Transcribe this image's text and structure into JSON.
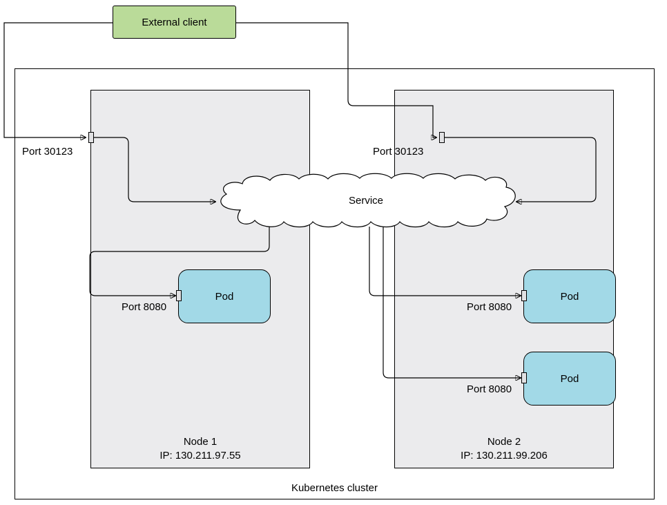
{
  "client": {
    "label": "External client"
  },
  "cluster": {
    "label": "Kubernetes cluster"
  },
  "service": {
    "label": "Service"
  },
  "nodes": [
    {
      "name": "Node 1",
      "ip_label": "IP: 130.211.97.55",
      "node_port_label": "Port 30123",
      "pods": [
        {
          "label": "Pod",
          "port_label": "Port 8080"
        }
      ]
    },
    {
      "name": "Node 2",
      "ip_label": "IP: 130.211.99.206",
      "node_port_label": "Port 30123",
      "pods": [
        {
          "label": "Pod",
          "port_label": "Port 8080"
        },
        {
          "label": "Pod",
          "port_label": "Port 8080"
        }
      ]
    }
  ]
}
